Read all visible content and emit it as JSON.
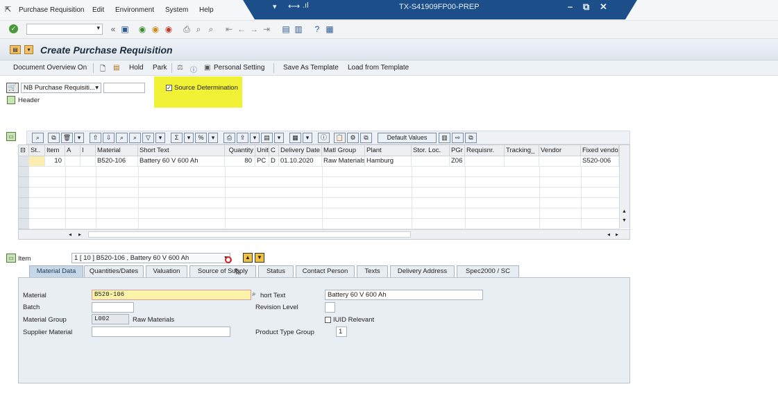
{
  "menubar": {
    "items": [
      "Purchase Requisition",
      "Edit",
      "Environment",
      "System",
      "Help"
    ],
    "system_title": "TX-S41909FP00-PREP"
  },
  "page": {
    "title": "Create Purchase Requisition"
  },
  "app_toolbar": {
    "doc_overview": "Document Overview On",
    "hold": "Hold",
    "park": "Park",
    "personal_setting": "Personal Setting",
    "save_template": "Save As Template",
    "load_template": "Load from Template"
  },
  "header_area": {
    "doc_type": "NB Purchase Requisiti...",
    "source_determination": "Source Determination",
    "header_label": "Header"
  },
  "table": {
    "default_values": "Default Values",
    "columns": [
      "St..",
      "Item",
      "A",
      "I",
      "Material",
      "Short Text",
      "Quantity",
      "Unit",
      "C",
      "Delivery Date",
      "Matl Group",
      "Plant",
      "Stor. Loc.",
      "PGr",
      "Requisnr.",
      "Tracking_",
      "Vendor",
      "Fixed vendo"
    ],
    "rows": [
      [
        "",
        "10",
        "",
        "",
        "B520-106",
        "Battery 60 V 600 Ah",
        "80",
        "PC",
        "D",
        "01.10.2020",
        "Raw Materials",
        "Hamburg",
        "",
        "Z06",
        "",
        "",
        "",
        "S520-006"
      ]
    ]
  },
  "item_area": {
    "item_label": "Item",
    "item_select": "1 [ 10 ] B520-106 , Battery 60 V 600 Ah",
    "tabs": [
      "Material Data",
      "Quantities/Dates",
      "Valuation",
      "Source of Supply",
      "Status",
      "Contact Person",
      "Texts",
      "Delivery Address",
      "Spec2000 / SC"
    ],
    "material_label": "Material",
    "material_value": "B520-106",
    "batch_label": "Batch",
    "material_group_label": "Material Group",
    "material_group_value": "L002",
    "material_group_desc": "Raw Materials",
    "supplier_material_label": "Supplier Material",
    "short_text_label": "hort Text",
    "short_text_value": "Battery 60 V 600 Ah",
    "revision_label": "Revision Level",
    "iuid_label": "IUID Relevant",
    "product_type_label": "Product Type Group",
    "product_type_value": "1"
  },
  "colors": {
    "accent": "#1c4f8a",
    "highlight": "#f0f02a"
  }
}
